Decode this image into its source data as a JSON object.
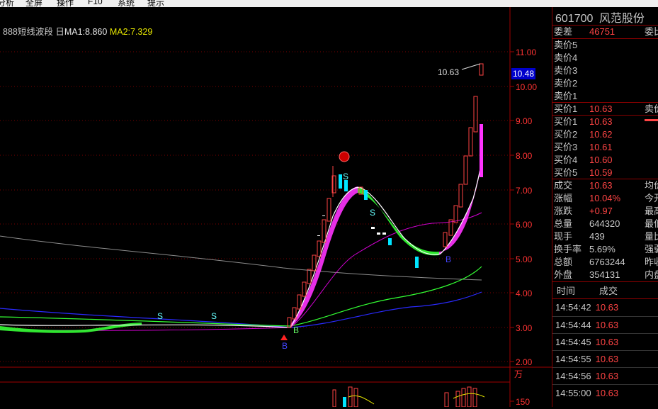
{
  "topbar": {
    "fragments": [
      "分析",
      "全屏",
      "操作",
      "F10",
      "系统",
      "提示"
    ]
  },
  "indicator": {
    "name": "888短线波段",
    "toggle": "日",
    "ma1": "MA1:8.860",
    "ma2": "MA2:7.329"
  },
  "price_axis": {
    "labels": [
      "11.00",
      "10.00",
      "9.00",
      "8.00",
      "7.00",
      "6.00",
      "5.00",
      "4.00",
      "3.00",
      "2.00"
    ],
    "current": "10.48",
    "high_marker": "10.63"
  },
  "volume_axis": {
    "unit": "万",
    "label_150": "150"
  },
  "chart_marks": {
    "sell": "S",
    "buy": "B"
  },
  "stock": {
    "code": "601700",
    "name": "风范股份"
  },
  "order_book": {
    "weibi_label": "委差",
    "weibi_value": "46751",
    "weibi_right": "委比",
    "sells": [
      {
        "label": "卖价5",
        "value": ""
      },
      {
        "label": "卖价4",
        "value": ""
      },
      {
        "label": "卖价3",
        "value": ""
      },
      {
        "label": "卖价2",
        "value": ""
      },
      {
        "label": "卖价1",
        "value": ""
      }
    ],
    "buy_top": {
      "label": "买价1",
      "value": "10.63",
      "right": "卖价"
    },
    "buys": [
      {
        "label": "买价1",
        "value": "10.63"
      },
      {
        "label": "买价2",
        "value": "10.62"
      },
      {
        "label": "买价3",
        "value": "10.61"
      },
      {
        "label": "买价4",
        "value": "10.60"
      },
      {
        "label": "买价5",
        "value": "10.59"
      }
    ]
  },
  "quote": [
    {
      "label": "成交",
      "value": "10.63",
      "right": "均价",
      "color": "#ff4444"
    },
    {
      "label": "涨幅",
      "value": "10.04%",
      "right": "今开",
      "color": "#ff4444"
    },
    {
      "label": "涨跌",
      "value": "+0.97",
      "right": "最高",
      "color": "#ff4444"
    },
    {
      "label": "总量",
      "value": "644320",
      "right": "最低",
      "color": "#c8c8c8"
    },
    {
      "label": "现手",
      "value": "439",
      "right": "量比",
      "color": "#c8c8c8"
    },
    {
      "label": "换手率",
      "value": "5.69%",
      "right": "强弱",
      "color": "#c8c8c8"
    },
    {
      "label": "总额",
      "value": "6763244",
      "right": "昨收",
      "color": "#c8c8c8"
    },
    {
      "label": "外盘",
      "value": "354131",
      "right": "内盘",
      "color": "#c8c8c8"
    }
  ],
  "ticks": {
    "time_header": "时间",
    "price_header": "成交",
    "rows": [
      {
        "time": "14:54:42",
        "price": "10.63"
      },
      {
        "time": "14:54:44",
        "price": "10.63"
      },
      {
        "time": "14:54:45",
        "price": "10.63"
      },
      {
        "time": "14:54:55",
        "price": "10.63"
      },
      {
        "time": "14:54:56",
        "price": "10.63"
      },
      {
        "time": "14:55:00",
        "price": "10.63"
      }
    ]
  }
}
